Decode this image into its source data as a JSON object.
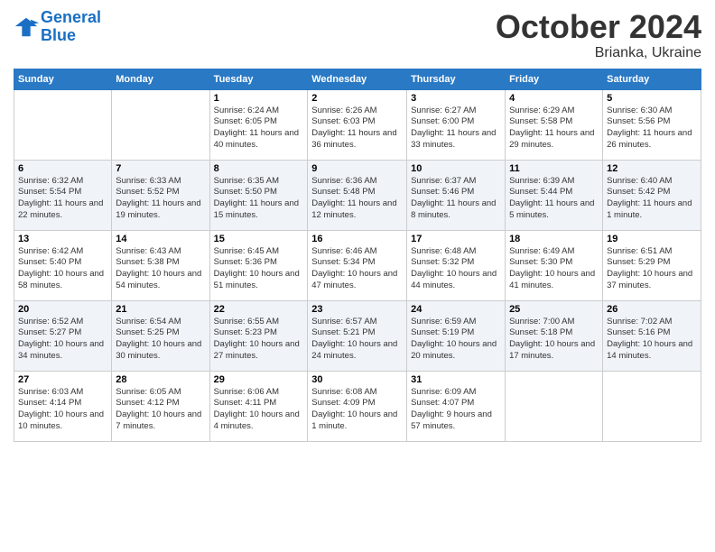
{
  "header": {
    "logo_line1": "General",
    "logo_line2": "Blue",
    "month_title": "October 2024",
    "subtitle": "Brianka, Ukraine"
  },
  "days_of_week": [
    "Sunday",
    "Monday",
    "Tuesday",
    "Wednesday",
    "Thursday",
    "Friday",
    "Saturday"
  ],
  "weeks": [
    [
      {
        "day": "",
        "info": ""
      },
      {
        "day": "",
        "info": ""
      },
      {
        "day": "1",
        "info": "Sunrise: 6:24 AM\nSunset: 6:05 PM\nDaylight: 11 hours and 40 minutes."
      },
      {
        "day": "2",
        "info": "Sunrise: 6:26 AM\nSunset: 6:03 PM\nDaylight: 11 hours and 36 minutes."
      },
      {
        "day": "3",
        "info": "Sunrise: 6:27 AM\nSunset: 6:00 PM\nDaylight: 11 hours and 33 minutes."
      },
      {
        "day": "4",
        "info": "Sunrise: 6:29 AM\nSunset: 5:58 PM\nDaylight: 11 hours and 29 minutes."
      },
      {
        "day": "5",
        "info": "Sunrise: 6:30 AM\nSunset: 5:56 PM\nDaylight: 11 hours and 26 minutes."
      }
    ],
    [
      {
        "day": "6",
        "info": "Sunrise: 6:32 AM\nSunset: 5:54 PM\nDaylight: 11 hours and 22 minutes."
      },
      {
        "day": "7",
        "info": "Sunrise: 6:33 AM\nSunset: 5:52 PM\nDaylight: 11 hours and 19 minutes."
      },
      {
        "day": "8",
        "info": "Sunrise: 6:35 AM\nSunset: 5:50 PM\nDaylight: 11 hours and 15 minutes."
      },
      {
        "day": "9",
        "info": "Sunrise: 6:36 AM\nSunset: 5:48 PM\nDaylight: 11 hours and 12 minutes."
      },
      {
        "day": "10",
        "info": "Sunrise: 6:37 AM\nSunset: 5:46 PM\nDaylight: 11 hours and 8 minutes."
      },
      {
        "day": "11",
        "info": "Sunrise: 6:39 AM\nSunset: 5:44 PM\nDaylight: 11 hours and 5 minutes."
      },
      {
        "day": "12",
        "info": "Sunrise: 6:40 AM\nSunset: 5:42 PM\nDaylight: 11 hours and 1 minute."
      }
    ],
    [
      {
        "day": "13",
        "info": "Sunrise: 6:42 AM\nSunset: 5:40 PM\nDaylight: 10 hours and 58 minutes."
      },
      {
        "day": "14",
        "info": "Sunrise: 6:43 AM\nSunset: 5:38 PM\nDaylight: 10 hours and 54 minutes."
      },
      {
        "day": "15",
        "info": "Sunrise: 6:45 AM\nSunset: 5:36 PM\nDaylight: 10 hours and 51 minutes."
      },
      {
        "day": "16",
        "info": "Sunrise: 6:46 AM\nSunset: 5:34 PM\nDaylight: 10 hours and 47 minutes."
      },
      {
        "day": "17",
        "info": "Sunrise: 6:48 AM\nSunset: 5:32 PM\nDaylight: 10 hours and 44 minutes."
      },
      {
        "day": "18",
        "info": "Sunrise: 6:49 AM\nSunset: 5:30 PM\nDaylight: 10 hours and 41 minutes."
      },
      {
        "day": "19",
        "info": "Sunrise: 6:51 AM\nSunset: 5:29 PM\nDaylight: 10 hours and 37 minutes."
      }
    ],
    [
      {
        "day": "20",
        "info": "Sunrise: 6:52 AM\nSunset: 5:27 PM\nDaylight: 10 hours and 34 minutes."
      },
      {
        "day": "21",
        "info": "Sunrise: 6:54 AM\nSunset: 5:25 PM\nDaylight: 10 hours and 30 minutes."
      },
      {
        "day": "22",
        "info": "Sunrise: 6:55 AM\nSunset: 5:23 PM\nDaylight: 10 hours and 27 minutes."
      },
      {
        "day": "23",
        "info": "Sunrise: 6:57 AM\nSunset: 5:21 PM\nDaylight: 10 hours and 24 minutes."
      },
      {
        "day": "24",
        "info": "Sunrise: 6:59 AM\nSunset: 5:19 PM\nDaylight: 10 hours and 20 minutes."
      },
      {
        "day": "25",
        "info": "Sunrise: 7:00 AM\nSunset: 5:18 PM\nDaylight: 10 hours and 17 minutes."
      },
      {
        "day": "26",
        "info": "Sunrise: 7:02 AM\nSunset: 5:16 PM\nDaylight: 10 hours and 14 minutes."
      }
    ],
    [
      {
        "day": "27",
        "info": "Sunrise: 6:03 AM\nSunset: 4:14 PM\nDaylight: 10 hours and 10 minutes."
      },
      {
        "day": "28",
        "info": "Sunrise: 6:05 AM\nSunset: 4:12 PM\nDaylight: 10 hours and 7 minutes."
      },
      {
        "day": "29",
        "info": "Sunrise: 6:06 AM\nSunset: 4:11 PM\nDaylight: 10 hours and 4 minutes."
      },
      {
        "day": "30",
        "info": "Sunrise: 6:08 AM\nSunset: 4:09 PM\nDaylight: 10 hours and 1 minute."
      },
      {
        "day": "31",
        "info": "Sunrise: 6:09 AM\nSunset: 4:07 PM\nDaylight: 9 hours and 57 minutes."
      },
      {
        "day": "",
        "info": ""
      },
      {
        "day": "",
        "info": ""
      }
    ]
  ]
}
